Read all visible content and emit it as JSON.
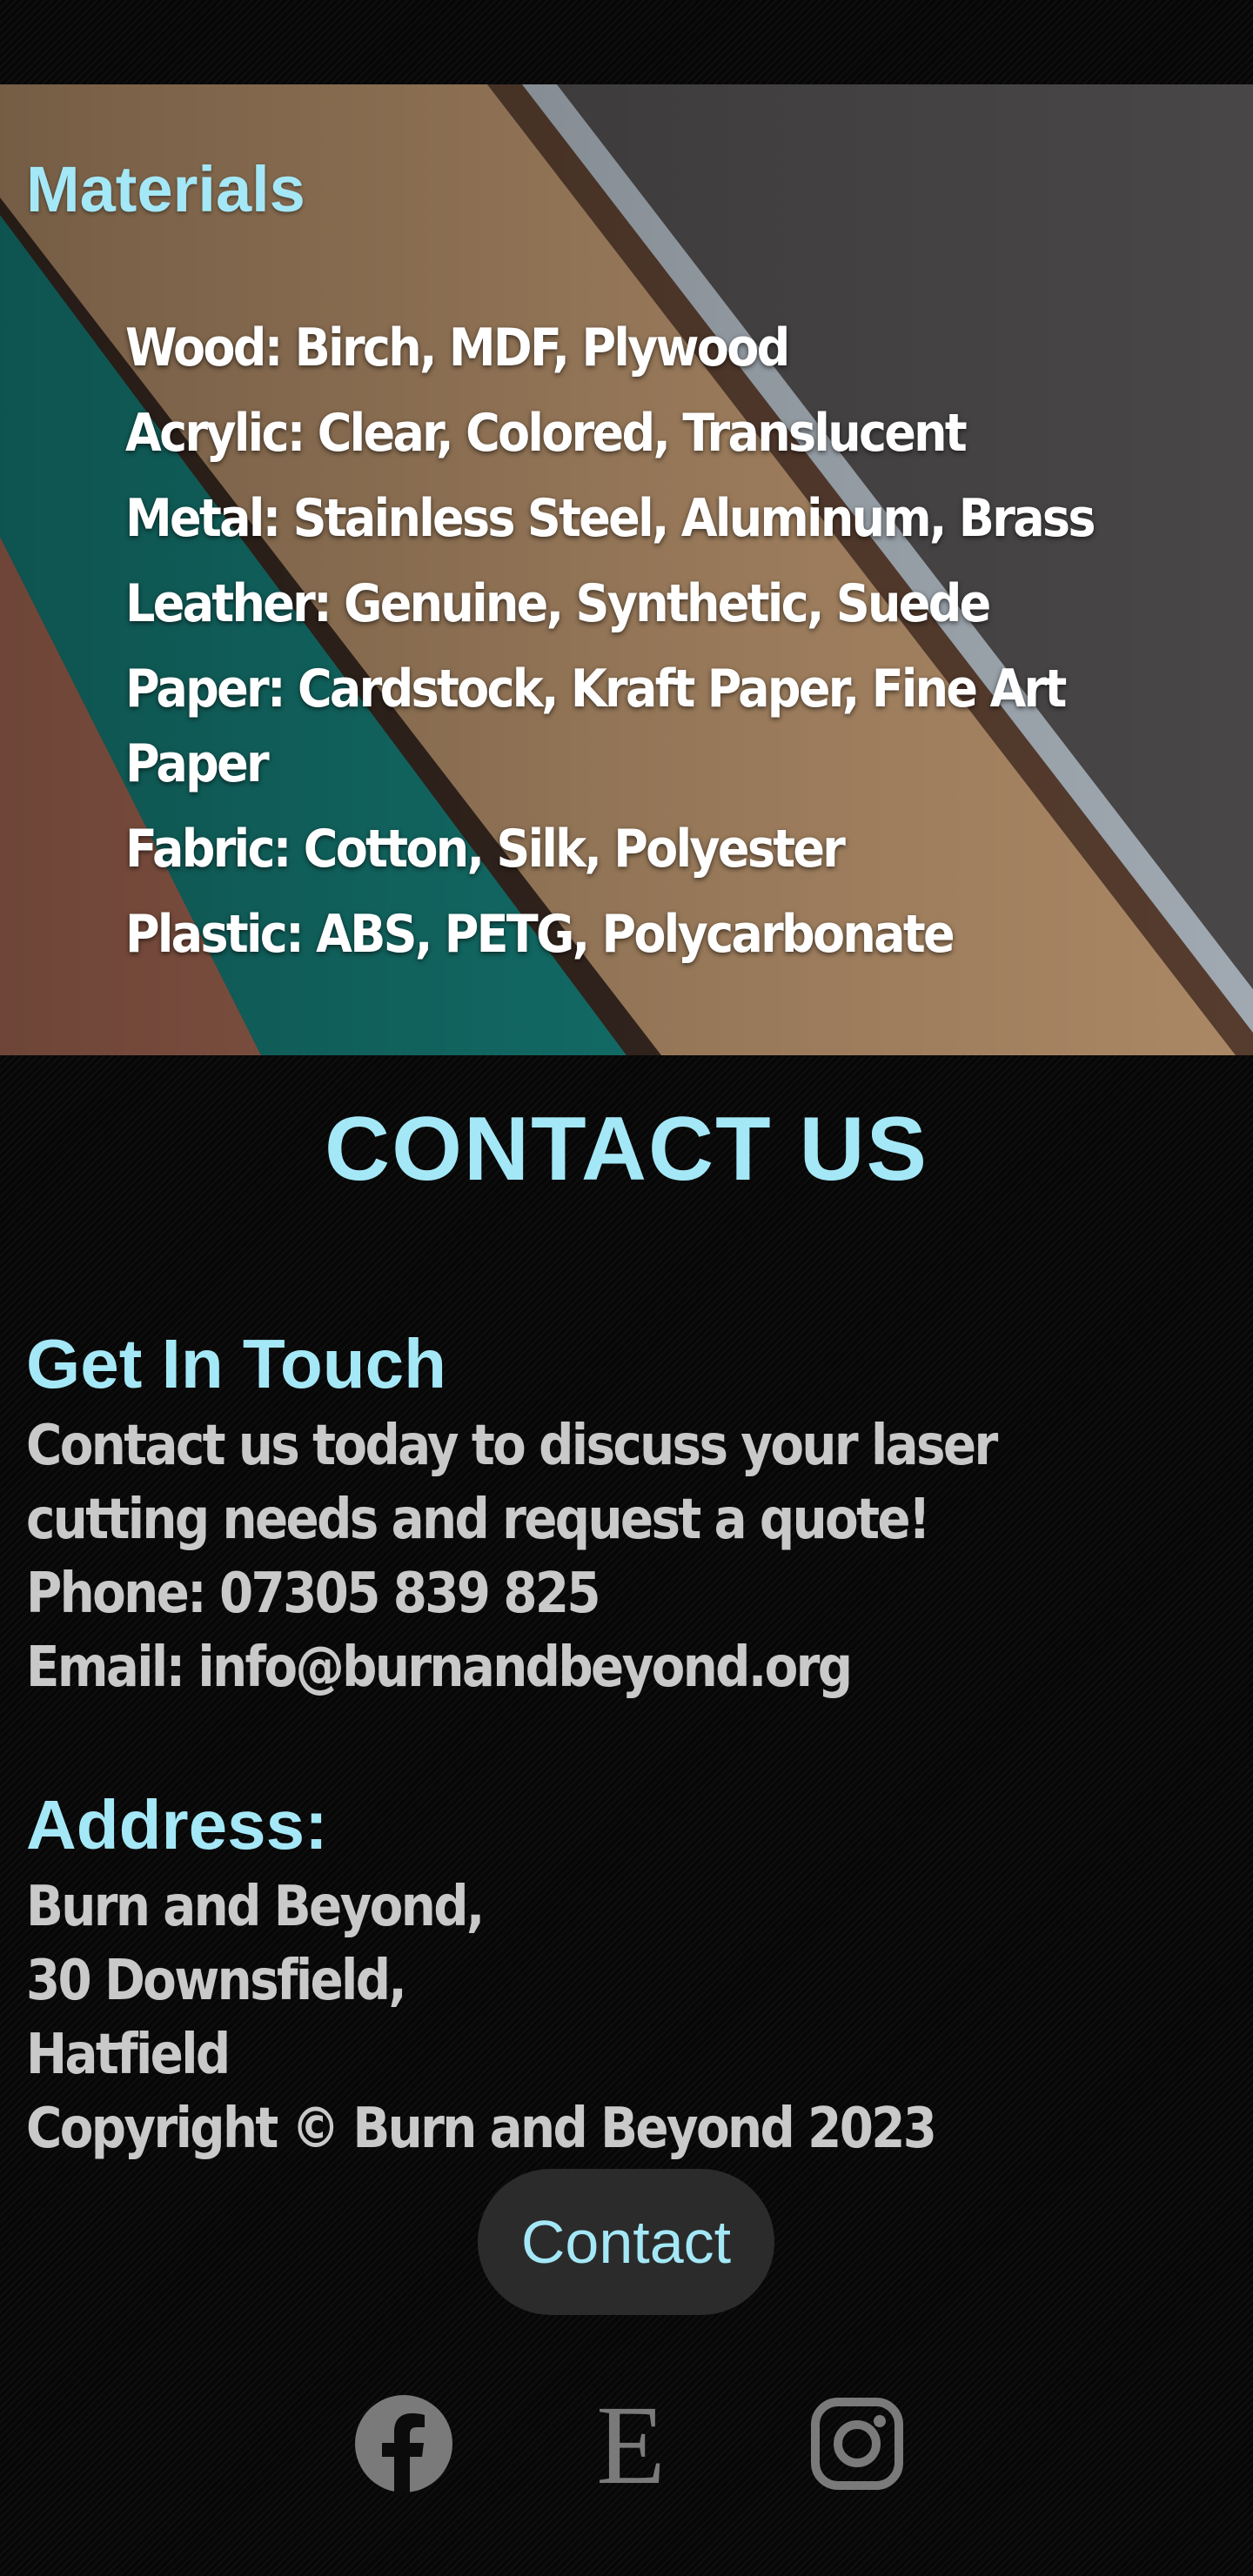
{
  "materials": {
    "title": "Materials",
    "items": [
      "Wood: Birch, MDF, Plywood",
      "Acrylic: Clear, Colored, Translucent",
      "Metal: Stainless Steel, Aluminum, Brass",
      "Leather: Genuine, Synthetic, Suede",
      "Paper: Cardstock, Kraft Paper, Fine Art Paper",
      "Fabric: Cotton, Silk, Polyester",
      "Plastic: ABS, PETG, Polycarbonate"
    ]
  },
  "contact": {
    "title": "CONTACT US",
    "touch_heading": "Get In Touch",
    "intro": "Contact us today to discuss your laser cutting needs and request a quote!",
    "phone": "Phone: 07305 839 825",
    "email": "Email: info@burnandbeyond.org",
    "address_heading": "Address:",
    "address_line1": "Burn and Beyond,",
    "address_line2": "30 Downsfield,",
    "address_line3": "Hatfield",
    "copyright": "Copyright © Burn and Beyond 2023",
    "button_label": "Contact"
  },
  "social": {
    "icons": [
      "facebook-icon",
      "etsy-icon",
      "instagram-icon"
    ],
    "etsy_letter": "E"
  },
  "colors": {
    "accent": "#a4e8f7",
    "text": "#c9c9c9",
    "background": "#0b0b0b",
    "button_bg": "#2b2b2b"
  }
}
